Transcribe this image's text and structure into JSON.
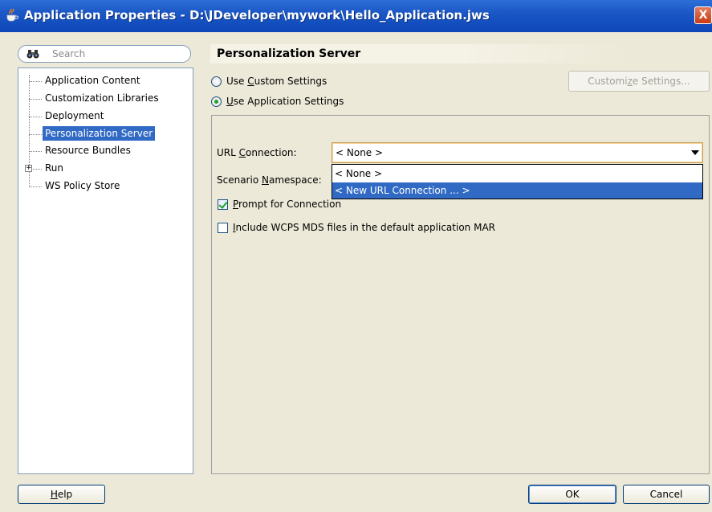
{
  "window": {
    "title": "Application Properties - D:\\JDeveloper\\mywork\\Hello_Application.jws",
    "close_label": "X"
  },
  "sidebar": {
    "search_placeholder": "Search",
    "items": [
      {
        "label": "Application Content",
        "selected": false
      },
      {
        "label": "Customization Libraries",
        "selected": false
      },
      {
        "label": "Deployment",
        "selected": false
      },
      {
        "label": "Personalization Server",
        "selected": true
      },
      {
        "label": "Resource Bundles",
        "selected": false
      },
      {
        "label": "Run",
        "selected": false,
        "expandable": true
      },
      {
        "label": "WS Policy Store",
        "selected": false
      }
    ]
  },
  "main": {
    "title": "Personalization Server",
    "radio_custom": {
      "label_pre": "Use ",
      "label_mnemonic": "C",
      "label_post": "ustom Settings",
      "checked": false
    },
    "radio_app": {
      "label_mnemonic": "U",
      "label_post": "se Application Settings",
      "checked": true
    },
    "customize_button": {
      "label_pre": "Customi",
      "label_mnemonic": "z",
      "label_post": "e Settings..."
    },
    "url_connection": {
      "label_pre": "URL ",
      "label_mnemonic": "C",
      "label_post": "onnection:",
      "value": "< None >"
    },
    "scenario_namespace": {
      "label_pre": "Scenario ",
      "label_mnemonic": "N",
      "label_post": "amespace:"
    },
    "dropdown_options": [
      "< None >",
      "< New URL Connection ... >"
    ],
    "prompt_checkbox": {
      "label_mnemonic": "P",
      "label_post": "rompt for Connection",
      "checked": true
    },
    "include_checkbox": {
      "label_mnemonic": "I",
      "label_post": "nclude WCPS MDS files in the default application MAR",
      "checked": false
    }
  },
  "footer": {
    "help": {
      "label_mnemonic": "H",
      "label_post": "elp"
    },
    "ok": "OK",
    "cancel": "Cancel"
  },
  "colors": {
    "titlebar": "#1b57c6",
    "selection": "#316ac5",
    "dialog_bg": "#ece9d8"
  }
}
